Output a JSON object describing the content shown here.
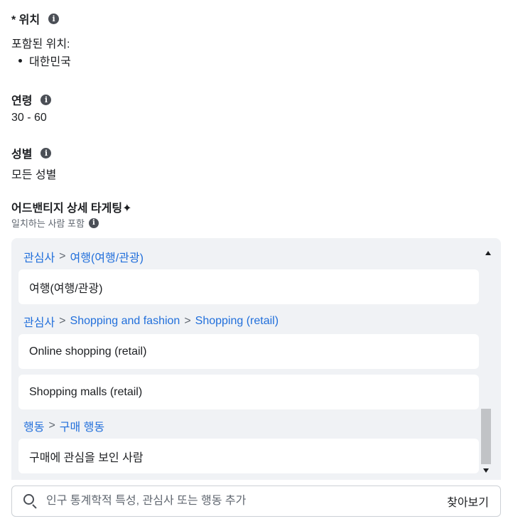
{
  "location": {
    "title": "* 위치",
    "included_label": "포함된 위치:",
    "items": [
      "대한민국"
    ]
  },
  "age": {
    "title": "연령",
    "value": "30 - 60"
  },
  "gender": {
    "title": "성별",
    "value": "모든 성별"
  },
  "targeting": {
    "title": "어드밴티지 상세 타게팅✦",
    "subtitle": "일치하는 사람 포함",
    "groups": [
      {
        "path": [
          "관심사",
          "여행(여행/관광)"
        ],
        "items": [
          "여행(여행/관광)"
        ]
      },
      {
        "path": [
          "관심사",
          "Shopping and fashion",
          "Shopping (retail)"
        ],
        "items": [
          "Online shopping (retail)",
          "Shopping malls (retail)"
        ]
      },
      {
        "path": [
          "행동",
          "구매 행동"
        ],
        "items": [
          "구매에 관심을 보인 사람"
        ]
      }
    ],
    "separator": ">"
  },
  "search": {
    "placeholder": "인구 통계학적 특성, 관심사 또는 행동 추가",
    "browse_label": "찾아보기"
  },
  "info_icon_glyph": "i",
  "colors": {
    "link": "#216fdb",
    "panel_bg": "#f0f2f5",
    "text": "#1c1e21",
    "muted": "#606770"
  }
}
